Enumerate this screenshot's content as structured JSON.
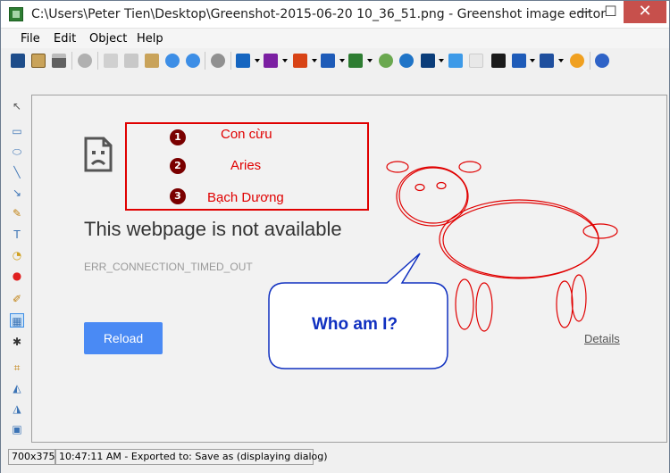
{
  "window": {
    "title": "C:\\Users\\Peter Tien\\Desktop\\Greenshot-2015-06-20 10_36_51.png - Greenshot image editor",
    "min_glyph": "—",
    "max_glyph": "☐",
    "close_glyph": "✕"
  },
  "menu": {
    "file": "File",
    "edit": "Edit",
    "object": "Object",
    "help": "Help"
  },
  "toolbar_icons": [
    "save-icon",
    "clipboard-icon",
    "print-icon",
    "delete-icon",
    "cut-icon",
    "copy-icon",
    "paste-icon",
    "undo-icon",
    "redo-icon",
    "settings-icon",
    "outlook-icon",
    "onenote-icon",
    "powerpoint-icon",
    "word-icon",
    "excel-icon",
    "paint-icon",
    "box-icon",
    "confluence-icon",
    "dropbox-icon",
    "flickr-icon",
    "imgur-icon",
    "jira-icon",
    "photobucket-icon",
    "picasa-icon",
    "help-icon"
  ],
  "colors": {
    "annotation_red": "#e00000",
    "bubble_blue": "#1030c0",
    "reload_blue": "#4a8af4",
    "close_button": "#c7504c"
  },
  "image": {
    "headline": "This webpage is not available",
    "error_code": "ERR_CONNECTION_TIMED_OUT",
    "reload_label": "Reload",
    "details_label": "Details",
    "annotations": [
      {
        "number": "1",
        "label": "Con cừu"
      },
      {
        "number": "2",
        "label": "Aries"
      },
      {
        "number": "3",
        "label": "Bạch Dương"
      }
    ],
    "speech_bubble": "Who am I?"
  },
  "status": {
    "dimensions": "700x375",
    "message": "10:47:11 AM - Exported to: Save as (displaying dialog)"
  }
}
